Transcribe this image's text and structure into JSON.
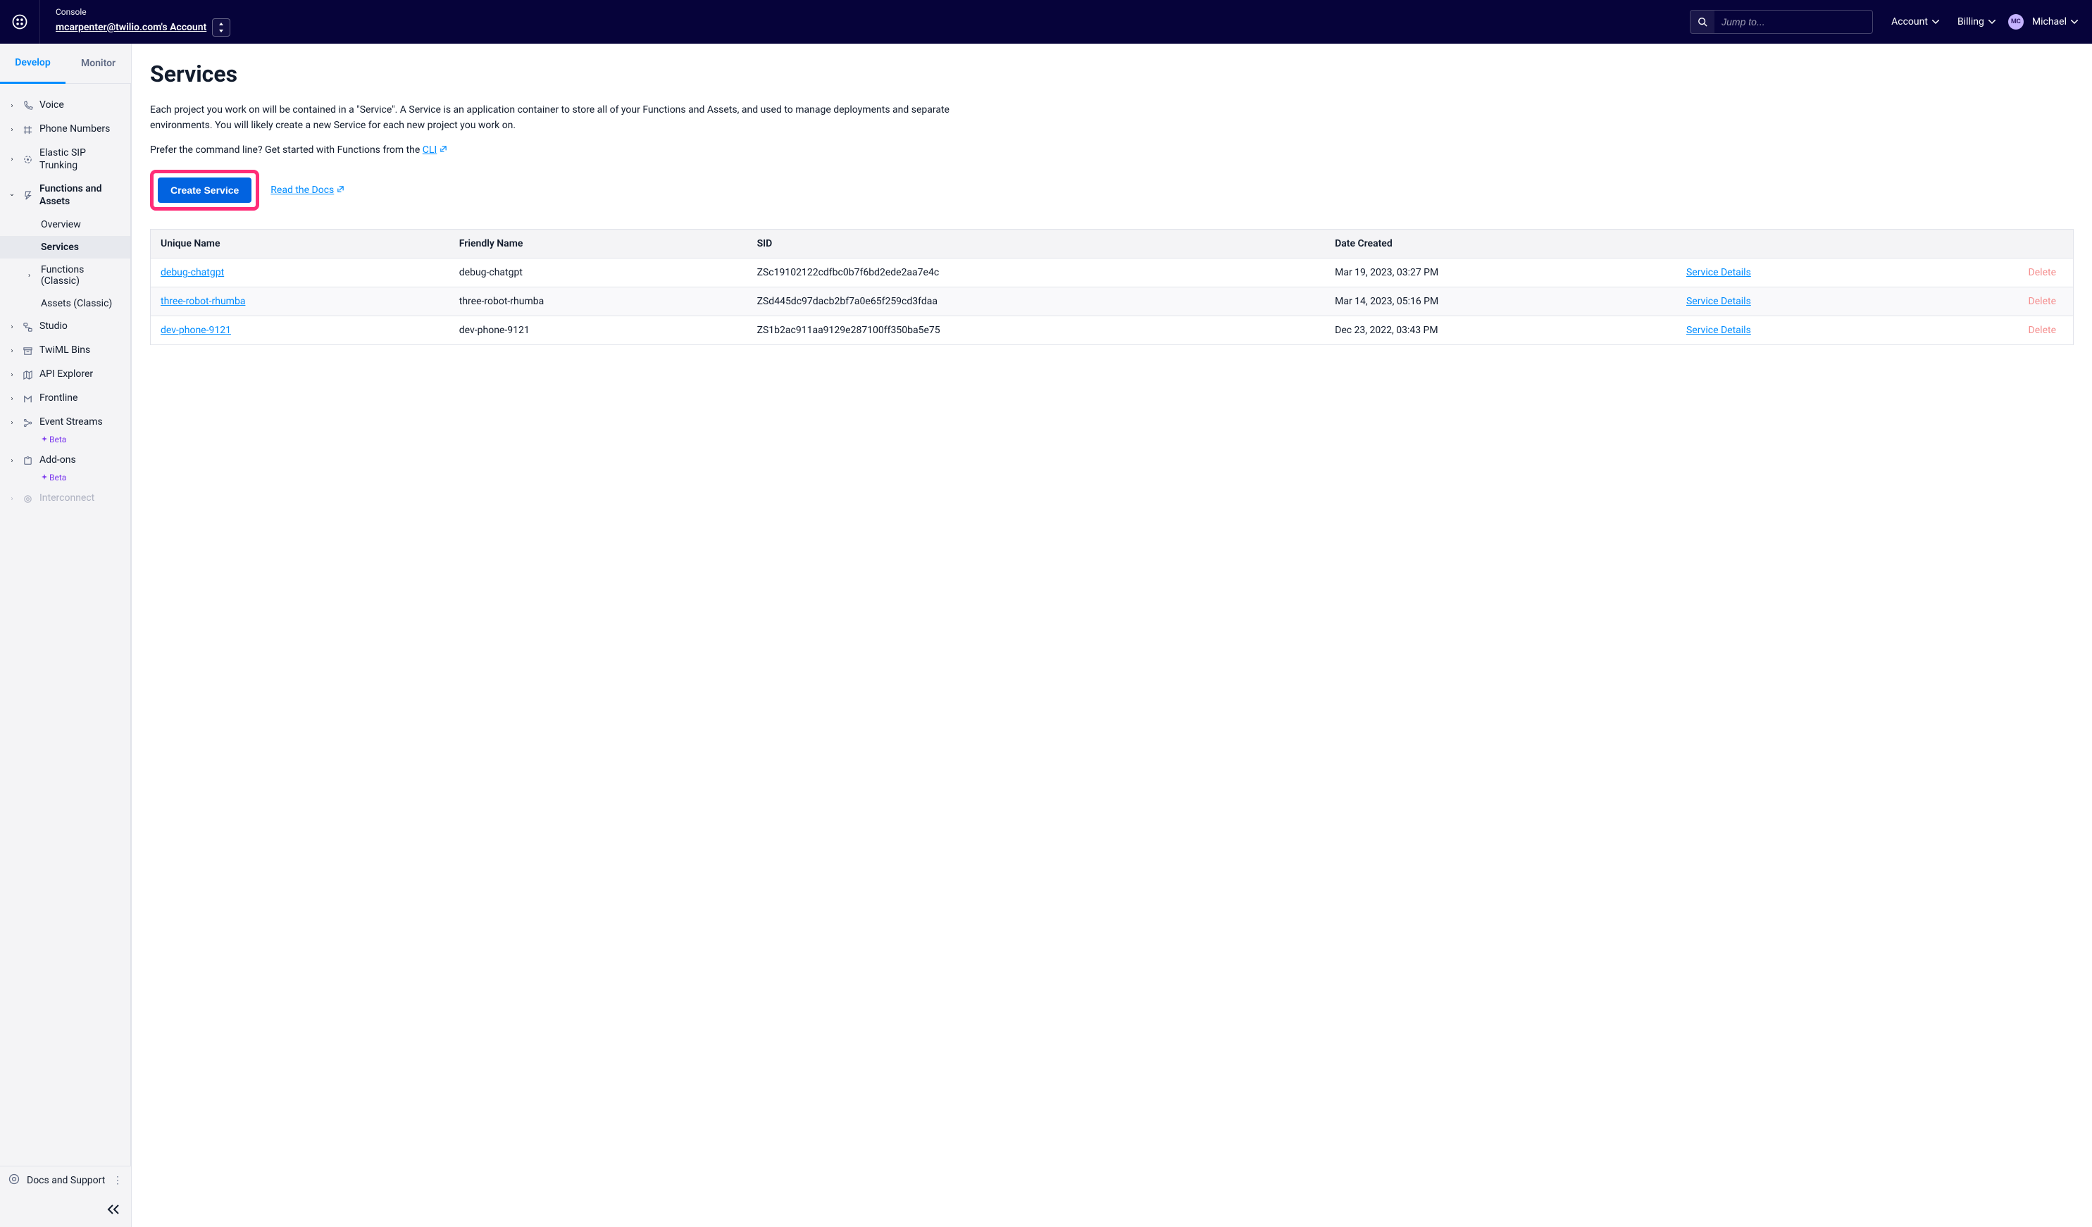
{
  "topbar": {
    "console_label": "Console",
    "account_text": "mcarpenter@twilio.com's Account",
    "search_placeholder": "Jump to...",
    "account_menu": "Account",
    "billing_menu": "Billing",
    "user_initials": "MC",
    "user_name": "Michael"
  },
  "tabs": {
    "develop": "Develop",
    "monitor": "Monitor"
  },
  "sidebar": {
    "voice": "Voice",
    "phone_numbers": "Phone Numbers",
    "elastic_sip": "Elastic SIP Trunking",
    "functions": "Functions and Assets",
    "overview": "Overview",
    "services": "Services",
    "functions_classic": "Functions (Classic)",
    "assets_classic": "Assets (Classic)",
    "studio": "Studio",
    "twiml_bins": "TwiML Bins",
    "api_explorer": "API Explorer",
    "frontline": "Frontline",
    "event_streams": "Event Streams",
    "addons": "Add-ons",
    "interconnect": "Interconnect",
    "beta": "Beta",
    "docs_support": "Docs and Support"
  },
  "page": {
    "title": "Services",
    "description": "Each project you work on will be contained in a \"Service\". A Service is an application container to store all of your Functions and Assets, and used to manage deployments and separate environments. You will likely create a new Service for each new project you work on.",
    "cli_prefix": "Prefer the command line? Get started with Functions from the ",
    "cli_link": "CLI",
    "create_btn": "Create Service",
    "read_docs": "Read the Docs"
  },
  "table": {
    "headers": {
      "unique_name": "Unique Name",
      "friendly_name": "Friendly Name",
      "sid": "SID",
      "date_created": "Date Created"
    },
    "service_details": "Service Details",
    "delete": "Delete",
    "rows": [
      {
        "unique": "debug-chatgpt",
        "friendly": "debug-chatgpt",
        "sid": "ZSc19102122cdfbc0b7f6bd2ede2aa7e4c",
        "date": "Mar 19, 2023, 03:27 PM"
      },
      {
        "unique": "three-robot-rhumba",
        "friendly": "three-robot-rhumba",
        "sid": "ZSd445dc97dacb2bf7a0e65f259cd3fdaa",
        "date": "Mar 14, 2023, 05:16 PM"
      },
      {
        "unique": "dev-phone-9121",
        "friendly": "dev-phone-9121",
        "sid": "ZS1b2ac911aa9129e287100ff350ba5e75",
        "date": "Dec 23, 2022, 03:43 PM"
      }
    ]
  }
}
